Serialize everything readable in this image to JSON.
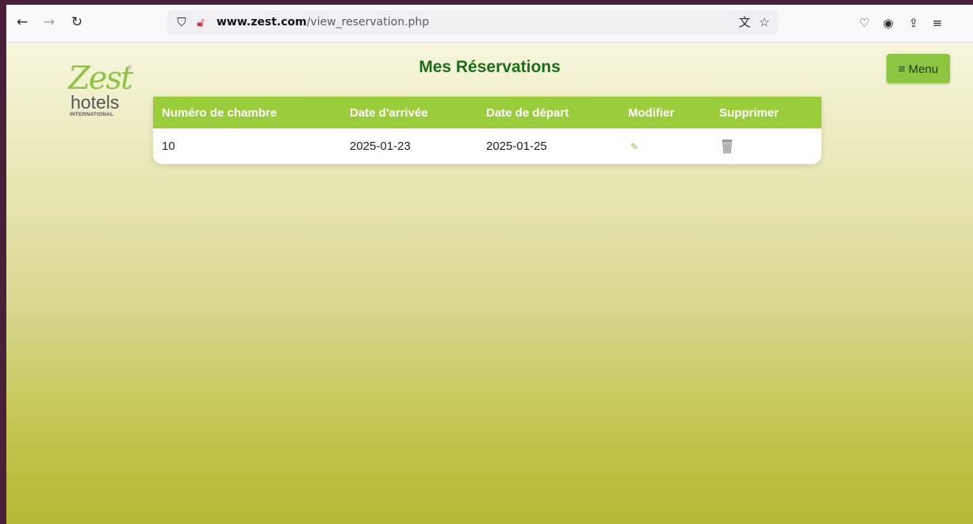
{
  "browser": {
    "url_domain": "www.zest.com",
    "url_path": "/view_reservation.php"
  },
  "logo": {
    "brand": "Zest",
    "word": "hotels",
    "sub": "INTERNATIONAL"
  },
  "page": {
    "title": "Mes Réservations",
    "menu_label": "≡ Menu"
  },
  "table": {
    "columns": [
      "Numéro de chambre",
      "Date d'arrivée",
      "Date de départ",
      "Modifier",
      "Supprimer"
    ],
    "rows": [
      {
        "room": "10",
        "arrival": "2025-01-23",
        "departure": "2025-01-25",
        "edit_icon": "pencil-icon",
        "delete_icon": "trash-icon"
      }
    ]
  },
  "colors": {
    "header_green": "#9acd3a",
    "title_green": "#1a6e1a",
    "button_green": "#8cc63f"
  }
}
